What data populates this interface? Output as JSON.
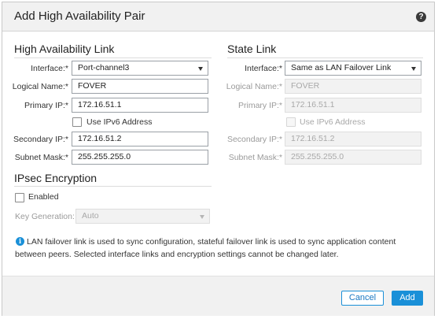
{
  "dialog": {
    "title": "Add High Availability Pair",
    "help_icon": "help-icon",
    "help_glyph": "?"
  },
  "ha_link": {
    "heading": "High Availability Link",
    "interface_label": "Interface:*",
    "interface_value": "Port-channel3",
    "logical_name_label": "Logical Name:*",
    "logical_name_value": "FOVER",
    "primary_ip_label": "Primary IP:*",
    "primary_ip_value": "172.16.51.1",
    "ipv6_label": "Use IPv6 Address",
    "ipv6_checked": false,
    "secondary_ip_label": "Secondary IP:*",
    "secondary_ip_value": "172.16.51.2",
    "subnet_mask_label": "Subnet Mask:*",
    "subnet_mask_value": "255.255.255.0"
  },
  "state_link": {
    "heading": "State Link",
    "interface_label": "Interface:*",
    "interface_value": "Same as LAN Failover Link",
    "logical_name_label": "Logical Name:*",
    "logical_name_value": "FOVER",
    "primary_ip_label": "Primary IP:*",
    "primary_ip_value": "172.16.51.1",
    "ipv6_label": "Use IPv6 Address",
    "ipv6_checked": false,
    "secondary_ip_label": "Secondary IP:*",
    "secondary_ip_value": "172.16.51.2",
    "subnet_mask_label": "Subnet Mask:*",
    "subnet_mask_value": "255.255.255.0"
  },
  "ipsec": {
    "heading": "IPsec Encryption",
    "enabled_label": "Enabled",
    "enabled_checked": false,
    "key_generation_label": "Key Generation:",
    "key_generation_value": "Auto"
  },
  "info": {
    "icon": "info-icon",
    "glyph": "i",
    "text": "LAN failover link is used to sync configuration, stateful failover link is used to sync application content between peers. Selected interface links and encryption settings cannot be changed later."
  },
  "footer": {
    "cancel_label": "Cancel",
    "add_label": "Add"
  },
  "colors": {
    "accent": "#1a90d8",
    "title_bar": "#f1f1f1",
    "disabled_text": "#a8a8a8"
  }
}
